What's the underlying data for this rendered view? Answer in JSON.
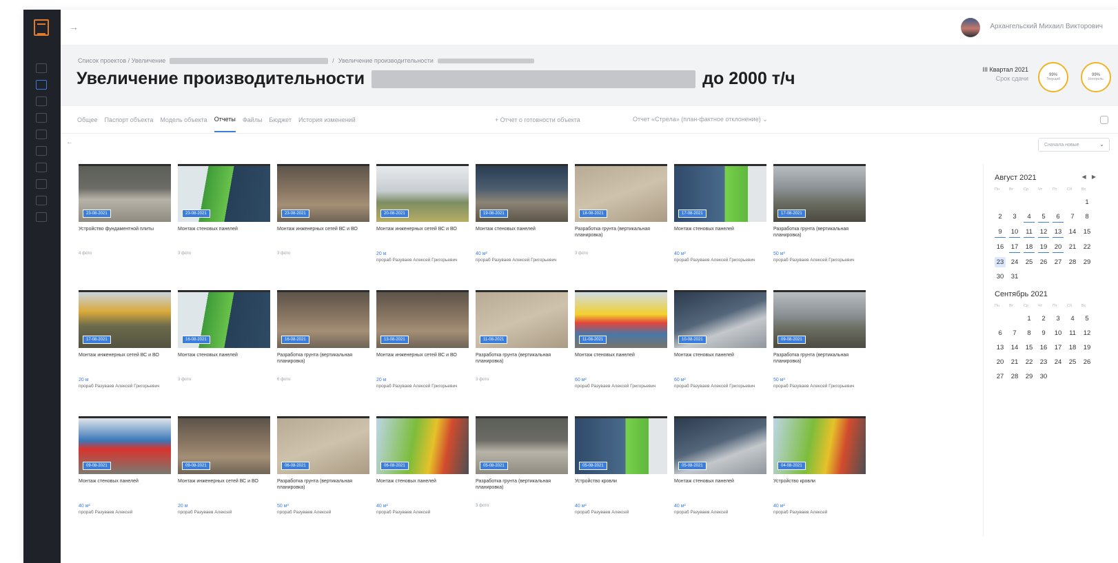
{
  "topbar": {
    "collapse_icon": "→",
    "username": "Архангельский Михаил Викторович"
  },
  "breadcrumb": {
    "root": "Список проектов / Увеличение",
    "sep": "/",
    "current": "Увеличение производительности"
  },
  "header": {
    "title_start": "Увеличение производительности",
    "title_end": "до 2000 т/ч",
    "quarter_label": "III Квартал 2021",
    "quarter_sub": "Срок сдачи",
    "progress": [
      {
        "pct": "99%",
        "label": "Текущий"
      },
      {
        "pct": "99%",
        "label": "Контроль"
      }
    ]
  },
  "tabs": [
    {
      "label": "Общее",
      "active": false
    },
    {
      "label": "Паспорт объекта",
      "active": false
    },
    {
      "label": "Модель объекта",
      "active": false
    },
    {
      "label": "Отчеты",
      "active": true
    },
    {
      "label": "Файлы",
      "active": false
    },
    {
      "label": "Бюджет",
      "active": false
    },
    {
      "label": "История изменений",
      "active": false
    }
  ],
  "report_links": {
    "readiness": "+ Отчет о готовности объекта",
    "strela": "Отчет «Стрела» (план-фактное отклонение) ⌄"
  },
  "sort": {
    "value": "Сначала новые",
    "chevron": "⌄"
  },
  "cards": [
    {
      "date": "23-08-2021",
      "work": "Устройство фундаментной плиты",
      "photos": "4 фото",
      "volume": "",
      "foreman": "",
      "img": "a"
    },
    {
      "date": "23-08-2021",
      "work": "Монтаж стеновых панелей",
      "photos": "3 фото",
      "volume": "",
      "foreman": "",
      "img": "b"
    },
    {
      "date": "23-08-2021",
      "work": "Монтаж инженерных сетей ВС и ВО",
      "photos": "3 фото",
      "volume": "",
      "foreman": "",
      "img": "c"
    },
    {
      "date": "20-08-2021",
      "work": "Монтаж инженерных сетей ВС и ВО",
      "photos": "",
      "volume": "20 м",
      "foreman": "прораб Разуваев Алексей Григорьевич",
      "img": "d"
    },
    {
      "date": "19-08-2021",
      "work": "Монтаж стеновых панелей",
      "photos": "",
      "volume": "40 м²",
      "foreman": "прораб Разуваев Алексей Григорьевич",
      "img": "e"
    },
    {
      "date": "18-08-2021",
      "work": "Разработка грунта (вертикальная планировка)",
      "photos": "3 фото",
      "volume": "",
      "foreman": "",
      "img": "f"
    },
    {
      "date": "17-08-2021",
      "work": "Монтаж стеновых панелей",
      "photos": "",
      "volume": "40 м²",
      "foreman": "прораб Разуваев Алексей Григорьевич",
      "img": "g"
    },
    {
      "date": "17-08-2021",
      "work": "Разработка грунта (вертикальная планировка)",
      "photos": "",
      "volume": "50 м³",
      "foreman": "прораб Разуваев Алексей Григорьевич",
      "img": "h"
    },
    {
      "date": "17-08-2021",
      "work": "Монтаж инженерных сетей ВС и ВО",
      "photos": "",
      "volume": "20 м",
      "foreman": "прораб Разуваев Алексей Григорьевич",
      "img": "i"
    },
    {
      "date": "16-08-2021",
      "work": "Монтаж стеновых панелей",
      "photos": "3 фото",
      "volume": "",
      "foreman": "",
      "img": "b"
    },
    {
      "date": "16-08-2021",
      "work": "Разработка грунта (вертикальная планировка)",
      "photos": "6 фото",
      "volume": "",
      "foreman": "",
      "img": "c"
    },
    {
      "date": "13-08-2021",
      "work": "Монтаж инженерных сетей ВС и ВО",
      "photos": "",
      "volume": "20 м",
      "foreman": "прораб Разуваев Алексей Григорьевич",
      "img": "c"
    },
    {
      "date": "11-08-2021",
      "work": "Разработка грунта (вертикальная планировка)",
      "photos": "3 фото",
      "volume": "",
      "foreman": "",
      "img": "f"
    },
    {
      "date": "11-08-2021",
      "work": "Монтаж стеновых панелей",
      "photos": "",
      "volume": "60 м²",
      "foreman": "прораб Разуваев Алексей Григорьевич",
      "img": "j"
    },
    {
      "date": "10-08-2021",
      "work": "Монтаж стеновых панелей",
      "photos": "",
      "volume": "60 м²",
      "foreman": "прораб Разуваев Алексей Григорьевич",
      "img": "k"
    },
    {
      "date": "09-08-2021",
      "work": "Разработка грунта (вертикальная планировка)",
      "photos": "",
      "volume": "50 м³",
      "foreman": "прораб Разуваев Алексей Григорьевич",
      "img": "h"
    },
    {
      "date": "09-08-2021",
      "work": "Монтаж стеновых панелей",
      "photos": "",
      "volume": "40 м²",
      "foreman": "прораб Разуваев Алексей",
      "img": "l"
    },
    {
      "date": "09-08-2021",
      "work": "Монтаж инженерных сетей ВС и ВО",
      "photos": "",
      "volume": "20 м",
      "foreman": "прораб Разуваев Алексей",
      "img": "c"
    },
    {
      "date": "06-08-2021",
      "work": "Разработка грунта (вертикальная планировка)",
      "photos": "",
      "volume": "50 м³",
      "foreman": "прораб Разуваев Алексей",
      "img": "f"
    },
    {
      "date": "06-08-2021",
      "work": "Монтаж стеновых панелей",
      "photos": "",
      "volume": "40 м²",
      "foreman": "прораб Разуваев Алексей",
      "img": "m"
    },
    {
      "date": "05-08-2021",
      "work": "Разработка грунта (вертикальная планировка)",
      "photos": "3 фото",
      "volume": "",
      "foreman": "",
      "img": "a"
    },
    {
      "date": "05-08-2021",
      "work": "Устройство кровли",
      "photos": "",
      "volume": "40 м²",
      "foreman": "прораб Разуваев Алексей",
      "img": "g"
    },
    {
      "date": "05-08-2021",
      "work": "Монтаж стеновых панелей",
      "photos": "",
      "volume": "40 м²",
      "foreman": "прораб Разуваев Алексей",
      "img": "k"
    },
    {
      "date": "04-08-2021",
      "work": "Устройство кровли",
      "photos": "",
      "volume": "40 м²",
      "foreman": "прораб Разуваев Алексей",
      "img": "m"
    }
  ],
  "calendar": {
    "weekdays": [
      "Пн",
      "Вт",
      "Ср",
      "Чт",
      "Пт",
      "Сб",
      "Вс"
    ],
    "nav": "◀ ▶",
    "months": [
      {
        "title": "Август 2021",
        "offset": 6,
        "days": 31,
        "underline": [
          4,
          5,
          6,
          9,
          10,
          11,
          12,
          13,
          17,
          18,
          19,
          20
        ],
        "selected": 23
      },
      {
        "title": "Сентябрь 2021",
        "offset": 2,
        "days": 30,
        "underline": [],
        "selected": 0
      }
    ]
  }
}
